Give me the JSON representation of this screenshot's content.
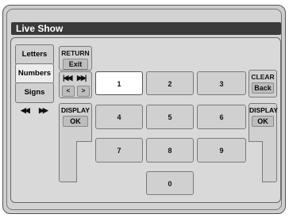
{
  "window": {
    "title": "Live Show"
  },
  "tabs": [
    {
      "label": "Letters"
    },
    {
      "label": "Numbers"
    },
    {
      "label": "Signs"
    }
  ],
  "tab_nav": {
    "prev": "◀◀",
    "next": "▶▶"
  },
  "return_key": {
    "label": "RETURN",
    "sub": "Exit"
  },
  "skip_nav": {
    "prev": "|◀◀",
    "next": "▶▶|"
  },
  "cursor": {
    "left": "<",
    "right": ">"
  },
  "clear_key": {
    "label": "CLEAR",
    "sub": "Back"
  },
  "display_left": {
    "label": "DISPLAY",
    "sub": "OK"
  },
  "display_right": {
    "label": "DISPLAY",
    "sub": "OK"
  },
  "digits": [
    "1",
    "2",
    "3",
    "4",
    "5",
    "6",
    "7",
    "8",
    "9",
    "0"
  ],
  "selected_digit": "1"
}
